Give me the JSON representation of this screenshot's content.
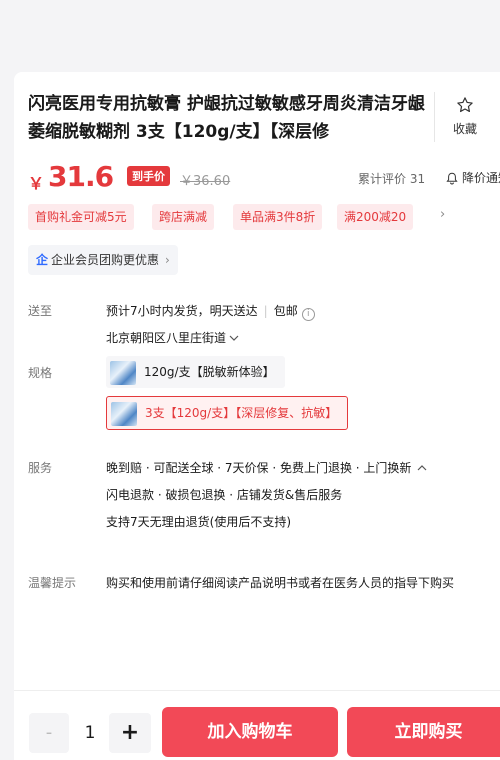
{
  "product": {
    "title": "闪亮医用专用抗敏膏 护龈抗过敏敏感牙周炎清洁牙龈萎缩脱敏糊剂 3支【120g/支】【深层修",
    "favorite_label": "收藏"
  },
  "price": {
    "currency": "￥",
    "current": "31.6",
    "tag": "到手价",
    "original": "￥36.60",
    "reviews": "累计评价 31",
    "notify": "降价通知"
  },
  "promotions": [
    "首购礼金可减5元",
    "跨店满减",
    "单品满3件8折",
    "满200减20"
  ],
  "enterprise": {
    "icon": "企",
    "label": "企业会员团购更优惠",
    "arrow": "›"
  },
  "delivery": {
    "label": "送至",
    "eta": "预计7小时内发货，明天送达",
    "shipping": "包邮",
    "info_icon": "i",
    "address": "北京朝阳区八里庄街道"
  },
  "spec": {
    "label": "规格",
    "options": [
      {
        "text": "120g/支【脱敏新体验】",
        "selected": false
      },
      {
        "text": "3支【120g/支】【深层修复、抗敏】",
        "selected": true
      }
    ]
  },
  "service": {
    "label": "服务",
    "line1": "晚到赔 · 可配送全球 · 7天价保 · 免费上门退换 · 上门换新 ",
    "line2": "闪电退款 · 破损包退换 · 店铺发货&售后服务",
    "line3": "支持7天无理由退货(使用后不支持)"
  },
  "tips": {
    "label": "温馨提示",
    "text": "购买和使用前请仔细阅读产品说明书或者在医务人员的指导下购买"
  },
  "bottom": {
    "minus": "-",
    "quantity": "1",
    "plus": "+",
    "add_to_cart": "加入购物车",
    "buy_now": "立即购买"
  },
  "colors": {
    "accent": "#e4393c",
    "button": "#f24957",
    "enterprise_icon": "#2f6bff"
  }
}
